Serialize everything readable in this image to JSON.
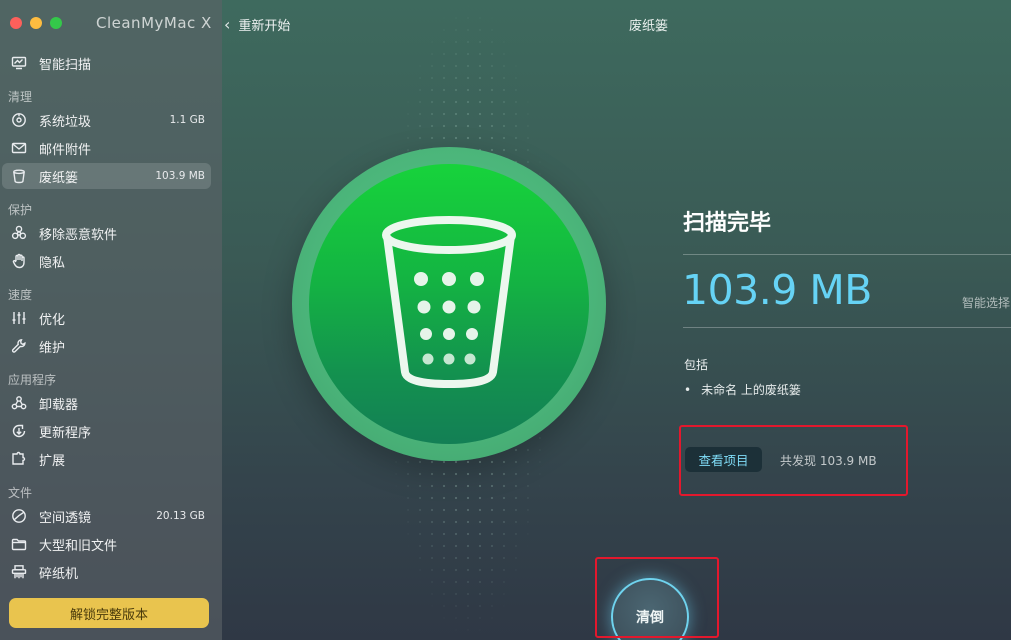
{
  "window": {
    "app_title": "CleanMyMac X"
  },
  "sidebar": {
    "sections": {
      "cleanup": "清理",
      "protect": "保护",
      "speed": "速度",
      "apps": "应用程序",
      "files": "文件"
    },
    "items": [
      {
        "label": "智能扫描",
        "size": "",
        "icon": "monitor-scan-icon"
      },
      {
        "label": "系统垃圾",
        "size": "1.1 GB",
        "icon": "disk-icon"
      },
      {
        "label": "邮件附件",
        "size": "",
        "icon": "mail-icon"
      },
      {
        "label": "废纸篓",
        "size": "103.9 MB",
        "icon": "trash-icon",
        "active": true
      },
      {
        "label": "移除恶意软件",
        "size": "",
        "icon": "biohazard-icon"
      },
      {
        "label": "隐私",
        "size": "",
        "icon": "hand-icon"
      },
      {
        "label": "优化",
        "size": "",
        "icon": "sliders-icon"
      },
      {
        "label": "维护",
        "size": "",
        "icon": "wrench-icon"
      },
      {
        "label": "卸载器",
        "size": "",
        "icon": "uninstaller-icon"
      },
      {
        "label": "更新程序",
        "size": "",
        "icon": "update-icon"
      },
      {
        "label": "扩展",
        "size": "",
        "icon": "extension-icon"
      },
      {
        "label": "空间透镜",
        "size": "20.13 GB",
        "icon": "lens-icon"
      },
      {
        "label": "大型和旧文件",
        "size": "",
        "icon": "folder-icon"
      },
      {
        "label": "碎纸机",
        "size": "",
        "icon": "shredder-icon"
      }
    ],
    "unlock_label": "解锁完整版本"
  },
  "header": {
    "back_label": "重新开始",
    "title": "废纸篓"
  },
  "result": {
    "heading": "扫描完毕",
    "size": "103.9 MB",
    "smart_label": "智能选择",
    "includes_label": "包括",
    "include_items": [
      "未命名 上的废纸篓"
    ],
    "view_items_label": "查看项目",
    "found_label": "共发现 103.9 MB",
    "clean_label": "清倒"
  },
  "colors": {
    "accent_blue": "#66d3f5",
    "unlock_yellow": "#e9c44e",
    "badge_green": "#14b542",
    "highlight_red": "#e3182d"
  }
}
